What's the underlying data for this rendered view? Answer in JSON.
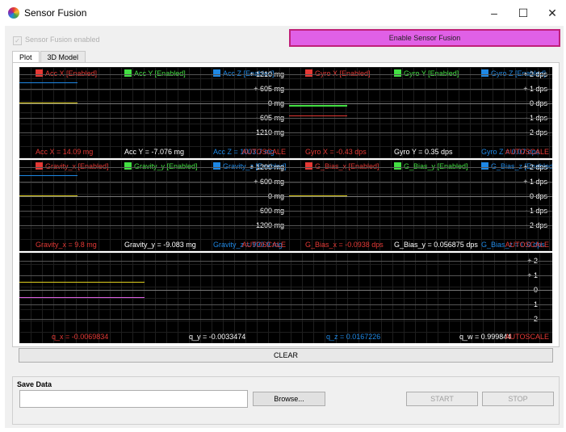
{
  "window": {
    "title": "Sensor Fusion"
  },
  "top": {
    "checkbox_label": "Sensor Fusion enabled",
    "enable_button": "Enable Sensor Fusion"
  },
  "tabs": [
    {
      "label": "Plot"
    },
    {
      "label": "3D Model"
    }
  ],
  "colors": {
    "red": "#e53935",
    "green": "#43e043",
    "blue": "#1e88e5",
    "yellow": "#e0d020",
    "magenta": "#e060e6"
  },
  "plots": {
    "acc": {
      "legend": [
        "Acc X [Enabled]",
        "Acc Y [Enabled]",
        "Acc Z [Enabled]"
      ],
      "ticks": [
        "+ 1210 mg",
        "+ 605 mg",
        "0 mg",
        "- 605 mg",
        "- 1210 mg"
      ],
      "readouts": [
        "Acc X = 14.09 mg",
        "Acc Y = -7.076 mg",
        "Acc Z = 1003.7 mg"
      ],
      "autoscale": "AUTOSCALE"
    },
    "gyro": {
      "legend": [
        "Gyro X [Enabled]",
        "Gyro Y [Enabled]",
        "Gyro Z [Enabled]"
      ],
      "ticks": [
        "+ 2 dps",
        "+ 1 dps",
        "0 dps",
        "- 1 dps",
        "- 2 dps"
      ],
      "readouts": [
        "Gyro X = -0.43 dps",
        "Gyro Y = 0.35 dps",
        "Gyro Z = 0.07 dps"
      ],
      "autoscale": "AUTOSCALE"
    },
    "gravity": {
      "legend": [
        "Gravity_x [Enabled]",
        "Gravity_y [Enabled]",
        "Gravity_z [Enabled]"
      ],
      "ticks": [
        "+ 1200 mg",
        "+ 600 mg",
        "0 mg",
        "- 600 mg",
        "- 1200 mg"
      ],
      "readouts": [
        "Gravity_x = 9.8 mg",
        "Gravity_y = -9.083 mg",
        "Gravity_z = 999.9 mg"
      ],
      "autoscale": "AUTOSCALE"
    },
    "gbias": {
      "legend": [
        "G_Bias_x [Enabled]",
        "G_Bias_y [Enabled]",
        "G_Bias_z [Enabled]"
      ],
      "ticks": [
        "+ 2 dps",
        "+ 1 dps",
        "0 dps",
        "- 1 dps",
        "- 2 dps"
      ],
      "readouts": [
        "G_Bias_x = -0.0938 dps",
        "G_Bias_y = 0.056875 dps",
        "G_Bias_z = 0.0 dps"
      ],
      "autoscale": "AUTOSCALE"
    },
    "quat": {
      "ticks": [
        "+ 2",
        "+ 1",
        "0",
        "- 1",
        "- 2"
      ],
      "readouts": [
        "q_x = -0.0069834",
        "q_y = -0.0033474",
        "q_z = 0.0167226",
        "q_w = 0.999844"
      ],
      "autoscale": "AUTOSCALE"
    }
  },
  "clear_button": "CLEAR",
  "save": {
    "label": "Save Data",
    "browse": "Browse...",
    "start": "START",
    "stop": "STOP"
  }
}
